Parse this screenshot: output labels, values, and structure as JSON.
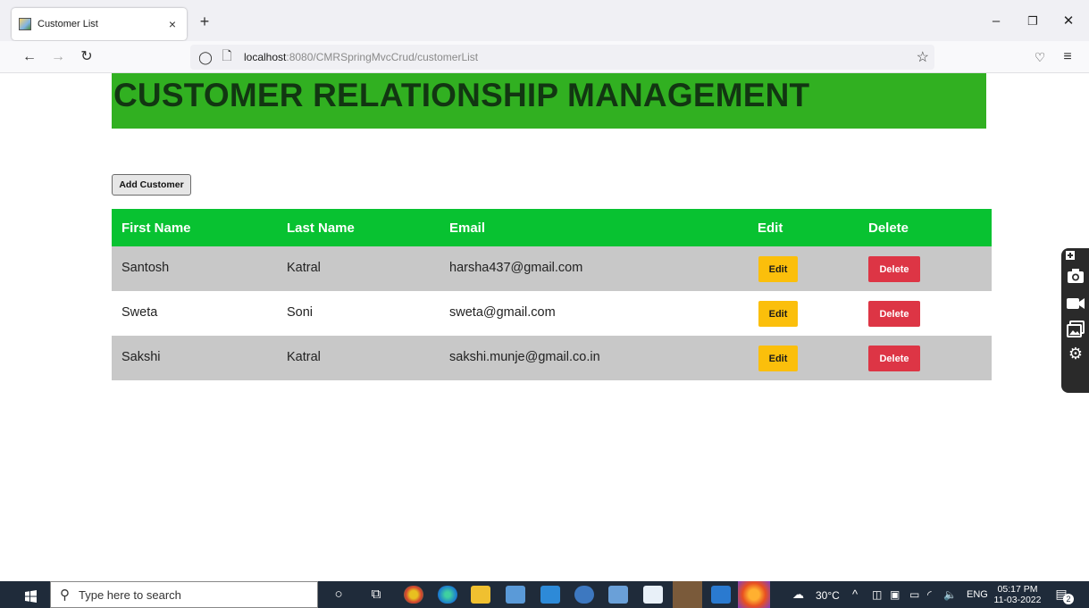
{
  "browser": {
    "tab_title": "Customer List",
    "tab_close": "×",
    "new_tab": "+",
    "url_host": "localhost",
    "url_path": ":8080/CMRSpringMvcCrud/customerList",
    "minimize": "–",
    "restore": "❐",
    "close": "✕"
  },
  "page": {
    "heading": "CUSTOMER RELATIONSHIP MANAGEMENT",
    "heading_bg": "#31b021",
    "add_button": "Add Customer",
    "table": {
      "header_bg": "#08c231",
      "columns": [
        "First Name",
        "Last Name",
        "Email",
        "Edit",
        "Delete"
      ],
      "rows": [
        {
          "first": "Santosh",
          "last": "Katral",
          "email": "harsha437@gmail.com",
          "edit": "Edit",
          "delete": "Delete"
        },
        {
          "first": "Sweta",
          "last": "Soni",
          "email": "sweta@gmail.com",
          "edit": "Edit",
          "delete": "Delete"
        },
        {
          "first": "Sakshi",
          "last": "Katral",
          "email": "sakshi.munje@gmail.co.in",
          "edit": "Edit",
          "delete": "Delete"
        }
      ],
      "edit_color": "#fbbf0b",
      "delete_color": "#dd3545"
    }
  },
  "capture_toolbar": {
    "icons": [
      "camera-icon",
      "video-icon",
      "gallery-icon",
      "settings-icon"
    ]
  },
  "taskbar": {
    "search_placeholder": "Type here to search",
    "weather": "30°C",
    "language": "ENG",
    "time": "05:17 PM",
    "date": "11-03-2022",
    "notification_count": "2"
  }
}
